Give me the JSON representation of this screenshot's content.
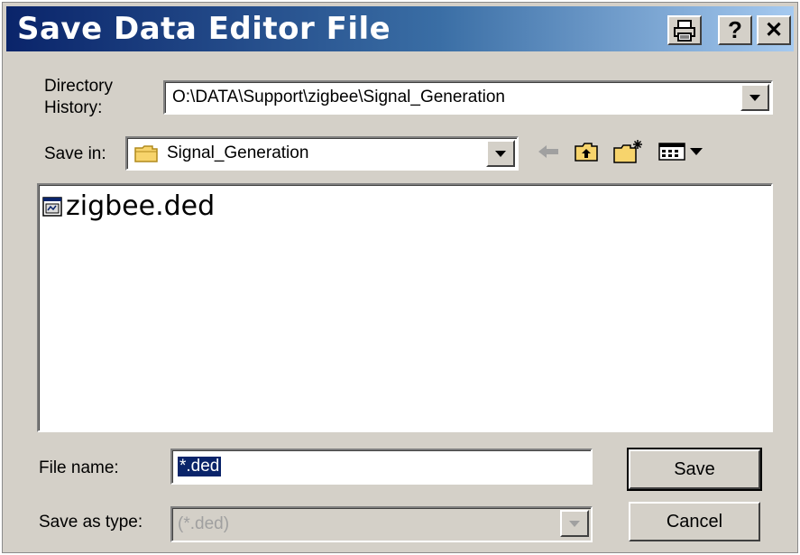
{
  "window": {
    "title": "Save Data Editor File",
    "buttons": {
      "print": "🖶",
      "help": "?",
      "close": "✕"
    }
  },
  "directory_history": {
    "label_line1": "Directory",
    "label_line2": "History:",
    "value": "O:\\DATA\\Support\\zigbee\\Signal_Generation"
  },
  "save_in": {
    "label": "Save in:",
    "value": "Signal_Generation",
    "toolbar": [
      "back-arrow-icon",
      "up-folder-icon",
      "new-folder-icon",
      "view-menu-icon"
    ]
  },
  "files": [
    {
      "name": "zigbee.ded",
      "icon": "ded-file-icon"
    }
  ],
  "file_name": {
    "label": "File name:",
    "value": "*.ded"
  },
  "save_as_type": {
    "label": "Save as type:",
    "value": "(*.ded)"
  },
  "actions": {
    "save": "Save",
    "cancel": "Cancel"
  },
  "colors": {
    "title_start": "#0a246a",
    "title_end": "#a6caf0",
    "face": "#d4d0c8",
    "selection": "#0a246a"
  }
}
